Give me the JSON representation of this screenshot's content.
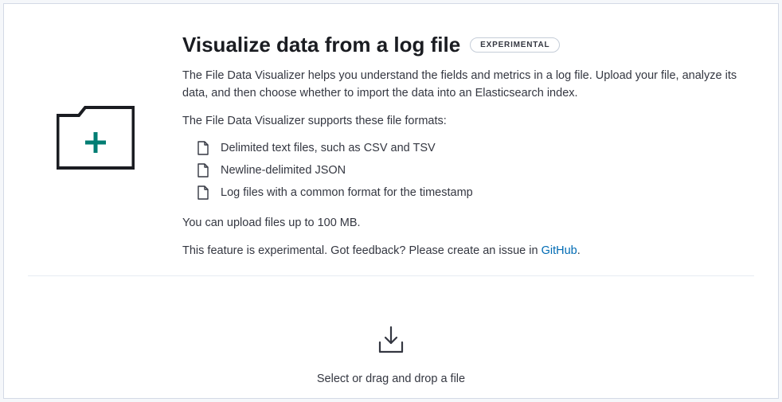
{
  "header": {
    "title": "Visualize data from a log file",
    "badge": "EXPERIMENTAL"
  },
  "intro": "The File Data Visualizer helps you understand the fields and metrics in a log file. Upload your file, analyze its data, and then choose whether to import the data into an Elasticsearch index.",
  "supports_label": "The File Data Visualizer supports these file formats:",
  "formats": [
    "Delimited text files, such as CSV and TSV",
    "Newline-delimited JSON",
    "Log files with a common format for the timestamp"
  ],
  "upload_limit": "You can upload files up to 100 MB.",
  "experimental_prefix": "This feature is experimental. Got feedback? Please create an issue in ",
  "experimental_link_label": "GitHub",
  "experimental_suffix": ".",
  "dropzone_label": "Select or drag and drop a file"
}
